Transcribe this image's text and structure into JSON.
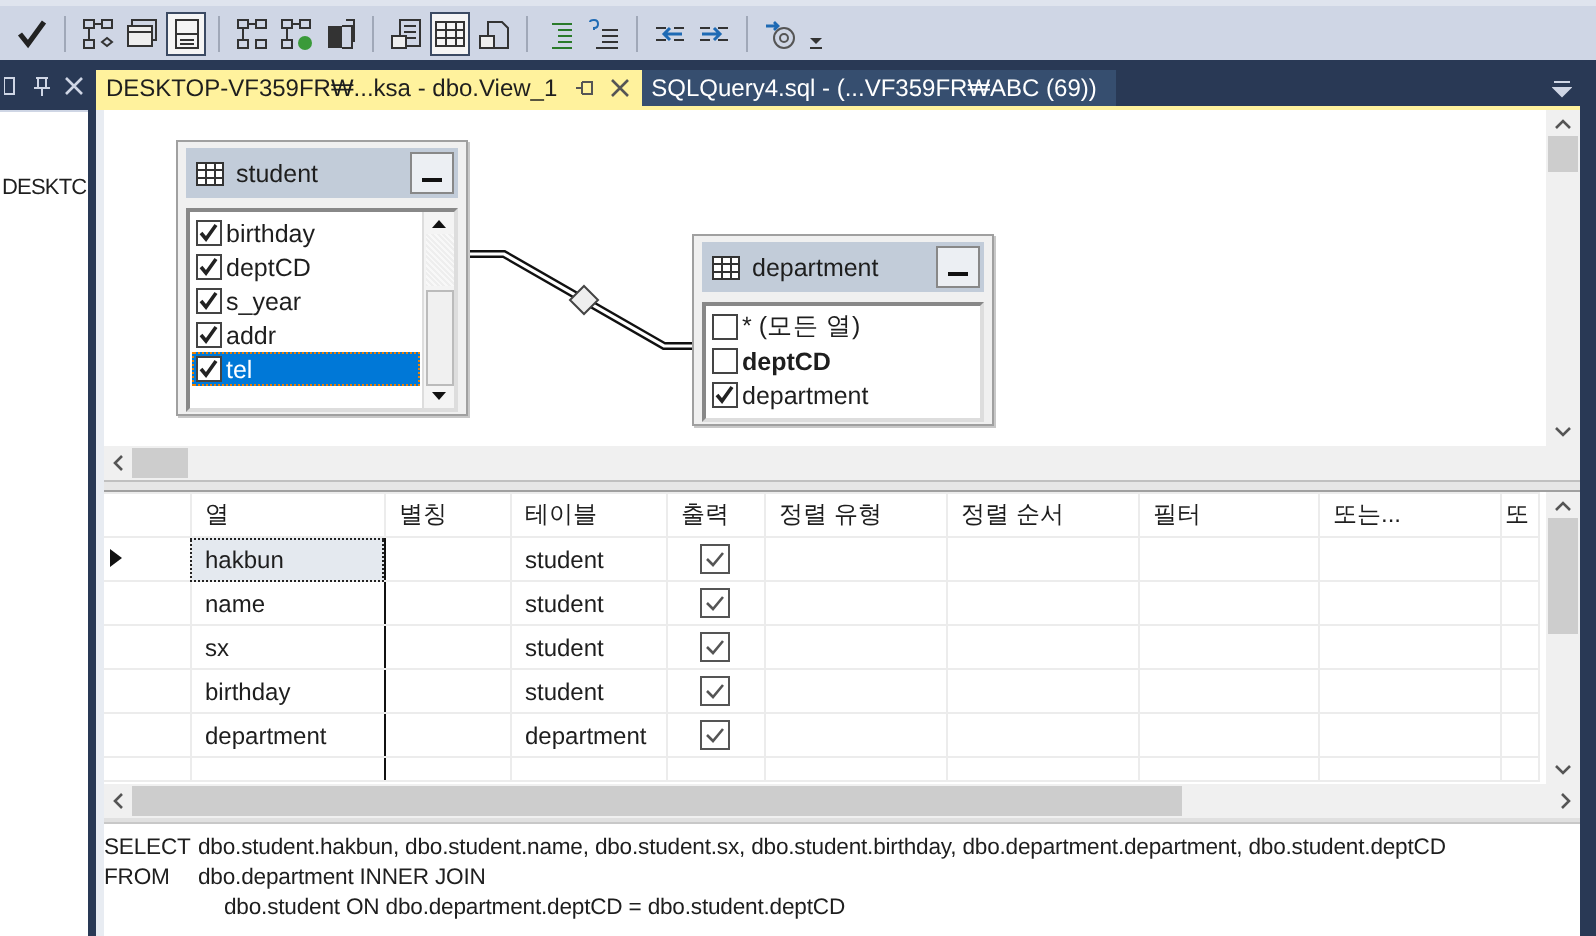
{
  "toolbar": {
    "items": [
      {
        "kind": "button",
        "selected": false
      },
      {
        "kind": "separator"
      },
      {
        "kind": "button",
        "selected": false
      },
      {
        "kind": "button",
        "selected": false
      },
      {
        "kind": "button",
        "selected": true
      },
      {
        "kind": "separator"
      },
      {
        "kind": "button",
        "selected": false
      },
      {
        "kind": "button",
        "selected": false
      },
      {
        "kind": "button",
        "selected": false
      },
      {
        "kind": "separator"
      },
      {
        "kind": "button",
        "selected": false
      },
      {
        "kind": "button",
        "selected": true
      },
      {
        "kind": "button",
        "selected": false
      },
      {
        "kind": "separator"
      },
      {
        "kind": "button",
        "selected": false
      },
      {
        "kind": "button",
        "selected": false
      },
      {
        "kind": "separator"
      },
      {
        "kind": "button",
        "selected": false
      },
      {
        "kind": "button",
        "selected": false
      },
      {
        "kind": "separator"
      },
      {
        "kind": "button",
        "selected": false
      },
      {
        "kind": "overflow"
      }
    ]
  },
  "side_panel": {
    "item": "DESKTC"
  },
  "document_tabs": [
    {
      "label": "DESKTOP-VF359FR₩...ksa - dbo.View_1",
      "selected": true
    },
    {
      "label": "SQLQuery4.sql - (...VF359FR₩ABC (69))",
      "selected": false
    }
  ],
  "diagram": {
    "tables": [
      {
        "name": "student",
        "scrollable": true,
        "columns": [
          {
            "name": "birthday",
            "checked": true,
            "selected": false,
            "key": false
          },
          {
            "name": "deptCD",
            "checked": true,
            "selected": false,
            "key": false
          },
          {
            "name": "s_year",
            "checked": true,
            "selected": false,
            "key": false
          },
          {
            "name": "addr",
            "checked": true,
            "selected": false,
            "key": false
          },
          {
            "name": "tel",
            "checked": true,
            "selected": true,
            "key": false
          }
        ]
      },
      {
        "name": "department",
        "scrollable": false,
        "columns": [
          {
            "name": "* (모든 열)",
            "checked": false,
            "selected": false,
            "key": false
          },
          {
            "name": "deptCD",
            "checked": false,
            "selected": false,
            "key": true
          },
          {
            "name": "department",
            "checked": true,
            "selected": false,
            "key": false
          }
        ]
      }
    ]
  },
  "grid": {
    "columns": [
      "열",
      "별칭",
      "테이블",
      "출력",
      "정렬 유형",
      "정렬 순서",
      "필터",
      "또는...",
      "또"
    ],
    "rows": [
      {
        "column": "hakbun",
        "table": "student",
        "output": true,
        "current": true
      },
      {
        "column": "name",
        "table": "student",
        "output": true,
        "current": false
      },
      {
        "column": "sx",
        "table": "student",
        "output": true,
        "current": false
      },
      {
        "column": "birthday",
        "table": "student",
        "output": true,
        "current": false
      },
      {
        "column": "department",
        "table": "department",
        "output": true,
        "current": false
      }
    ]
  },
  "sql": {
    "lines": [
      {
        "kind": "clause",
        "keyword": "SELECT",
        "text": "dbo.student.hakbun, dbo.student.name, dbo.student.sx, dbo.student.birthday, dbo.department.department, dbo.student.deptCD"
      },
      {
        "kind": "clause",
        "keyword": "FROM",
        "text": "dbo.department INNER JOIN"
      },
      {
        "kind": "continuation",
        "text": "dbo.student ON dbo.department.deptCD = dbo.student.deptCD"
      }
    ]
  }
}
